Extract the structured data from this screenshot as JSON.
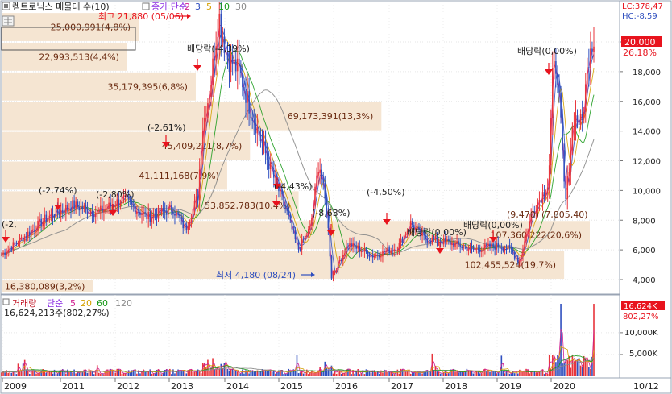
{
  "colors": {
    "candle_up": "#e8343b",
    "candle_down": "#2f4fbf",
    "ma2": "#d02090",
    "ma3": "#2f4fbf",
    "ma5": "#d4a000",
    "ma10": "#1a9a1a",
    "ma30": "#8a8a8a",
    "vol": "#c01020",
    "vol_ma5": "#d02090",
    "vol_ma20": "#d4a000",
    "vol_ma60": "#1a9a1a",
    "vol_ma120": "#8a8a8a",
    "annotation_bg": "#f5e5d2",
    "badge_red": "#e8131d"
  },
  "header": {
    "title": "켐트로닉스 매물대 수(10)",
    "ma_prefix": "종가 단순",
    "ma_periods": [
      "2",
      "3",
      "5",
      "10",
      "30"
    ],
    "lc": "LC:378,47",
    "hc": "HC:-8,59"
  },
  "right_axis": {
    "price_badge": "20,000",
    "pct": "26,18%",
    "ticks": [
      "18,000",
      "16,000",
      "14,000",
      "12,000",
      "10,000",
      "8,000",
      "6,000",
      "4,000"
    ]
  },
  "volume_panel": {
    "title": "거래량",
    "ma_prefix": "단순",
    "ma_periods": [
      "5",
      "20",
      "60",
      "120"
    ],
    "last_value": "16,624,213주(802,27%)",
    "badge": "16,624K",
    "pct": "802,27%",
    "ticks": [
      "10,000K",
      "5,000K"
    ]
  },
  "x_axis": {
    "labels": [
      "2009",
      "2011",
      "2012",
      "2013",
      "2014",
      "2015",
      "2016",
      "2017",
      "2018",
      "2019",
      "2020",
      "10/12"
    ]
  },
  "annotations": {
    "high": "최고 21,880 (05/06)",
    "low": "최저 4,180 (08/24)",
    "dividend_markers": [
      "배당락(-4,39%)",
      "배당락(0,00%)",
      "배당락(0,00%)",
      "배당락(0,00%)"
    ],
    "pct_markers": [
      "(-2,74%)",
      "(-2,80%)",
      "(-2,61%)",
      "(-8,63%)",
      "(-4,50%)",
      "(-4,43%)",
      "(-2,"
    ]
  },
  "chart_data": {
    "type": "candlestick-with-volume-profile",
    "price_range": [
      3300,
      22800
    ],
    "price_axis_ticks": [
      4000,
      6000,
      8000,
      10000,
      12000,
      14000,
      16000,
      18000,
      20000
    ],
    "current_price": 20000,
    "high": {
      "value": 21880,
      "date": "05/06"
    },
    "low": {
      "value": 4180,
      "date": "08/24"
    },
    "volume_profile": [
      {
        "label": "25,000,991(4,8%)",
        "pct": 4.8,
        "low": 20000,
        "high": 22000
      },
      {
        "label": "22,993,513(4,4%)",
        "pct": 4.4,
        "low": 18000,
        "high": 20000
      },
      {
        "label": "35,179,395(6,8%)",
        "pct": 6.8,
        "low": 16000,
        "high": 18000
      },
      {
        "label": "69,173,391(13,3%)",
        "pct": 13.3,
        "low": 14000,
        "high": 16000
      },
      {
        "label": "45,409,221(8,7%)",
        "pct": 8.7,
        "low": 12000,
        "high": 14000
      },
      {
        "label": "41,111,168(7,9%)",
        "pct": 7.9,
        "low": 10000,
        "high": 12000
      },
      {
        "label": "53,852,783(10,4%)",
        "pct": 10.4,
        "low": 8000,
        "high": 10000
      },
      {
        "label": "107,360,222(20,6%)",
        "pct": 20.6,
        "low": 6000,
        "high": 8000
      },
      {
        "label": "102,455,524(19,7%)",
        "pct": 19.7,
        "low": 4000,
        "high": 6000
      },
      {
        "label": "16,380,089(3,2%)",
        "pct": 3.2,
        "low": 2000,
        "high": 4000
      }
    ],
    "extra_labels": [
      "(9,470)",
      "(7,805,40)"
    ],
    "moving_averages": [
      2,
      3,
      5,
      10,
      30
    ],
    "volume_ma": [
      5,
      20,
      60,
      120
    ],
    "volume_range_k": [
      0,
      17000
    ],
    "volume_ticks_k": [
      5000,
      10000
    ],
    "last_volume": 16624213,
    "last_volume_pct": 802.27,
    "price_path": [
      [
        "2009-01",
        5700
      ],
      [
        "2009-06",
        6800
      ],
      [
        "2009-12",
        8200
      ],
      [
        "2010-06",
        9000
      ],
      [
        "2010-12",
        8500
      ],
      [
        "2011-06",
        9400
      ],
      [
        "2011-12",
        8200
      ],
      [
        "2012-06",
        8800
      ],
      [
        "2012-09",
        7400
      ],
      [
        "2012-12",
        9600
      ],
      [
        "2013-01",
        14000
      ],
      [
        "2013-03",
        17000
      ],
      [
        "2013-05",
        21880
      ],
      [
        "2013-07",
        19000
      ],
      [
        "2013-10",
        18000
      ],
      [
        "2013-12",
        16000
      ],
      [
        "2014-03",
        13500
      ],
      [
        "2014-06",
        11000
      ],
      [
        "2014-09",
        8800
      ],
      [
        "2014-12",
        6000
      ],
      [
        "2015-03",
        7500
      ],
      [
        "2015-05",
        12000
      ],
      [
        "2015-07",
        8300
      ],
      [
        "2015-08",
        4180
      ],
      [
        "2015-12",
        6400
      ],
      [
        "2016-06",
        5600
      ],
      [
        "2016-12",
        6200
      ],
      [
        "2017-03",
        7800
      ],
      [
        "2017-06",
        6800
      ],
      [
        "2017-12",
        6500
      ],
      [
        "2018-06",
        6000
      ],
      [
        "2018-12",
        6300
      ],
      [
        "2019-03",
        6000
      ],
      [
        "2019-05",
        5200
      ],
      [
        "2019-08",
        8500
      ],
      [
        "2019-12",
        10500
      ],
      [
        "2020-01",
        17800
      ],
      [
        "2020-02",
        18600
      ],
      [
        "2020-03",
        14000
      ],
      [
        "2020-04",
        9000
      ],
      [
        "2020-06",
        15000
      ],
      [
        "2020-08",
        14500
      ],
      [
        "2020-10",
        20000
      ]
    ]
  }
}
